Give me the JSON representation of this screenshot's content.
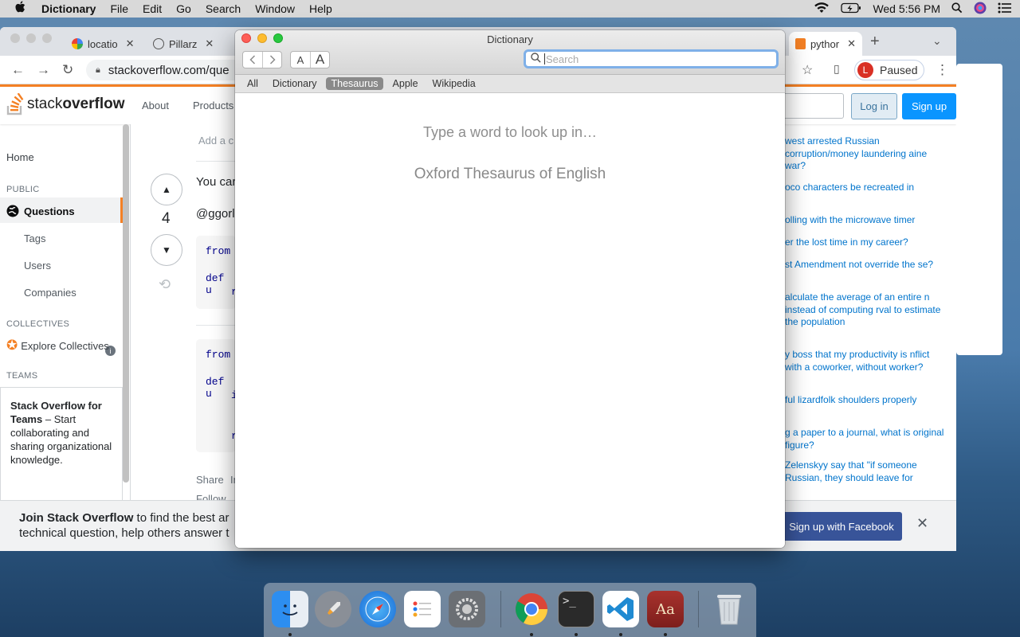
{
  "menubar": {
    "app_name": "Dictionary",
    "menus": [
      "File",
      "Edit",
      "Go",
      "Search",
      "Window",
      "Help"
    ],
    "clock": "Wed 5:56 PM"
  },
  "browser": {
    "tabs": [
      "locatio",
      "Pillarz",
      "pythor"
    ],
    "url": "stackoverflow.com/que",
    "profile_initial": "L",
    "profile_status": "Paused"
  },
  "stackoverflow": {
    "logo_light": "stack",
    "logo_bold": "overflow",
    "nav": [
      "About",
      "Products"
    ],
    "login_label": "Log in",
    "signup_label": "Sign up",
    "sidebar": {
      "home": "Home",
      "public_header": "PUBLIC",
      "questions": "Questions",
      "tags": "Tags",
      "users": "Users",
      "companies": "Companies",
      "collectives_header": "COLLECTIVES",
      "explore_collectives": "Explore Collectives",
      "teams_header": "TEAMS",
      "teams_title": "Stack Overflow for Teams",
      "teams_text": " – Start collaborating and sharing organizational knowledge."
    },
    "answer": {
      "add_comment": "Add a c",
      "text_fragment": "You car",
      "mention": "@ggorl",
      "vote_count": "4",
      "code1": [
        "from",
        "def u",
        "r"
      ],
      "code2": [
        "from",
        "def u",
        "i",
        "r"
      ],
      "share": "Share",
      "improve": "Im",
      "follow": "Follow"
    },
    "hot_questions": [
      "west arrested Russian corruption/money laundering aine war?",
      "oco characters be recreated in",
      "olling with the microwave timer",
      "er the lost time in my career?",
      "st Amendment not override the se?",
      "alculate the average of an entire n instead of computing rval to estimate the population",
      "y boss that my productivity is nflict with a coworker, without worker?",
      "ful lizardfolk shoulders properly",
      "g a paper to a journal, what is original figure?",
      "Zelenskyy say that \"if someone Russian, they should leave for"
    ],
    "join_bold": "Join Stack Overflow",
    "join_text": " to find the best ar",
    "join_line2": "technical question, help others answer t",
    "facebook_signup": "Sign up with Facebook"
  },
  "dictionary": {
    "window_title": "Dictionary",
    "font_small": "A",
    "font_large": "A",
    "search_placeholder": "Search",
    "sources": [
      "All",
      "Dictionary",
      "Thesaurus",
      "Apple",
      "Wikipedia"
    ],
    "active_source": "Thesaurus",
    "prompt_line1": "Type a word to look up in…",
    "prompt_line2": "Oxford Thesaurus of English"
  },
  "dock": {
    "apps": [
      "finder-icon",
      "launchpad-icon",
      "safari-icon",
      "reminders-icon",
      "system-preferences-icon",
      "chrome-icon",
      "terminal-icon",
      "vscode-icon",
      "dictionary-icon",
      "trash-icon"
    ],
    "dictionary_label": "Aa",
    "terminal_prompt": ">_"
  }
}
